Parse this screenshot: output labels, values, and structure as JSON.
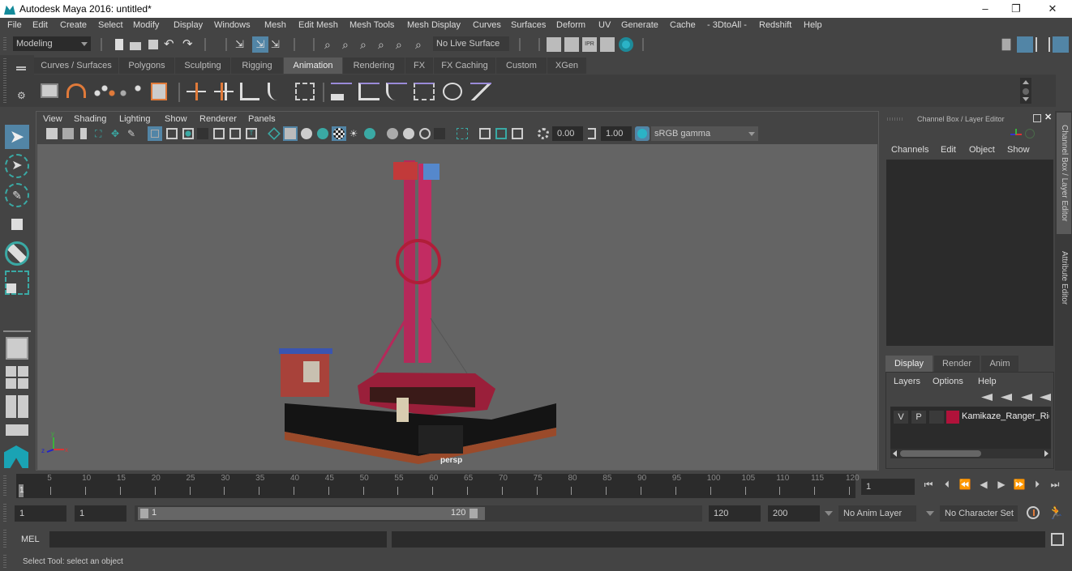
{
  "window": {
    "title": "Autodesk Maya 2016: untitled*",
    "minimize": "–",
    "maximize": "❐",
    "close": "✕"
  },
  "menubar": [
    "File",
    "Edit",
    "Create",
    "Select",
    "Modify",
    "Display",
    "Windows",
    "Mesh",
    "Edit Mesh",
    "Mesh Tools",
    "Mesh Display",
    "Curves",
    "Surfaces",
    "Deform",
    "UV",
    "Generate",
    "Cache",
    "- 3DtoAll -",
    "Redshift",
    "Help"
  ],
  "status_line": {
    "menu_set": "Modeling",
    "live_surface": "No Live Surface"
  },
  "shelf_tabs": [
    {
      "label": "Curves / Surfaces",
      "active": false
    },
    {
      "label": "Polygons",
      "active": false
    },
    {
      "label": "Sculpting",
      "active": false
    },
    {
      "label": "Rigging",
      "active": false
    },
    {
      "label": "Animation",
      "active": true
    },
    {
      "label": "Rendering",
      "active": false
    },
    {
      "label": "FX",
      "active": false
    },
    {
      "label": "FX Caching",
      "active": false
    },
    {
      "label": "Custom",
      "active": false
    },
    {
      "label": "XGen",
      "active": false
    }
  ],
  "viewport": {
    "menu": [
      "View",
      "Shading",
      "Lighting",
      "Show",
      "Renderer",
      "Panels"
    ],
    "exposure": "0.00",
    "gamma": "1.00",
    "color_space": "sRGB gamma",
    "camera_label": "persp",
    "axis": {
      "x": "x",
      "y": "y",
      "z": "z"
    }
  },
  "channel_box": {
    "title": "Channel Box / Layer Editor",
    "menu": [
      "Channels",
      "Edit",
      "Object",
      "Show"
    ]
  },
  "layer_editor": {
    "tabs": [
      {
        "label": "Display",
        "active": true
      },
      {
        "label": "Render",
        "active": false
      },
      {
        "label": "Anim",
        "active": false
      }
    ],
    "menu": [
      "Layers",
      "Options",
      "Help"
    ],
    "layers": [
      {
        "v": "V",
        "p": "P",
        "color": "#b0123a",
        "name": "Kamikaze_Ranger_Ride"
      }
    ]
  },
  "side_tabs": [
    "Channel Box / Layer Editor",
    "Attribute Editor"
  ],
  "timeline": {
    "ticks": [
      1,
      5,
      10,
      15,
      20,
      25,
      30,
      35,
      40,
      45,
      50,
      55,
      60,
      65,
      70,
      75,
      80,
      85,
      90,
      95,
      100,
      105,
      110,
      115,
      120
    ],
    "current_frame_marker": "1",
    "current_frame": "1"
  },
  "range": {
    "start": "1",
    "playback_start": "1",
    "slider_start": "1",
    "slider_end": "120",
    "playback_end": "120",
    "end": "200",
    "anim_layer": "No Anim Layer",
    "character_set": "No Character Set"
  },
  "command_line": {
    "label": "MEL",
    "value": "",
    "result": ""
  },
  "help_line": "Select Tool: select an object",
  "colors": {
    "accent": "#5285a6",
    "layer_color": "#b0123a",
    "key_orange": "#e07a3a"
  }
}
